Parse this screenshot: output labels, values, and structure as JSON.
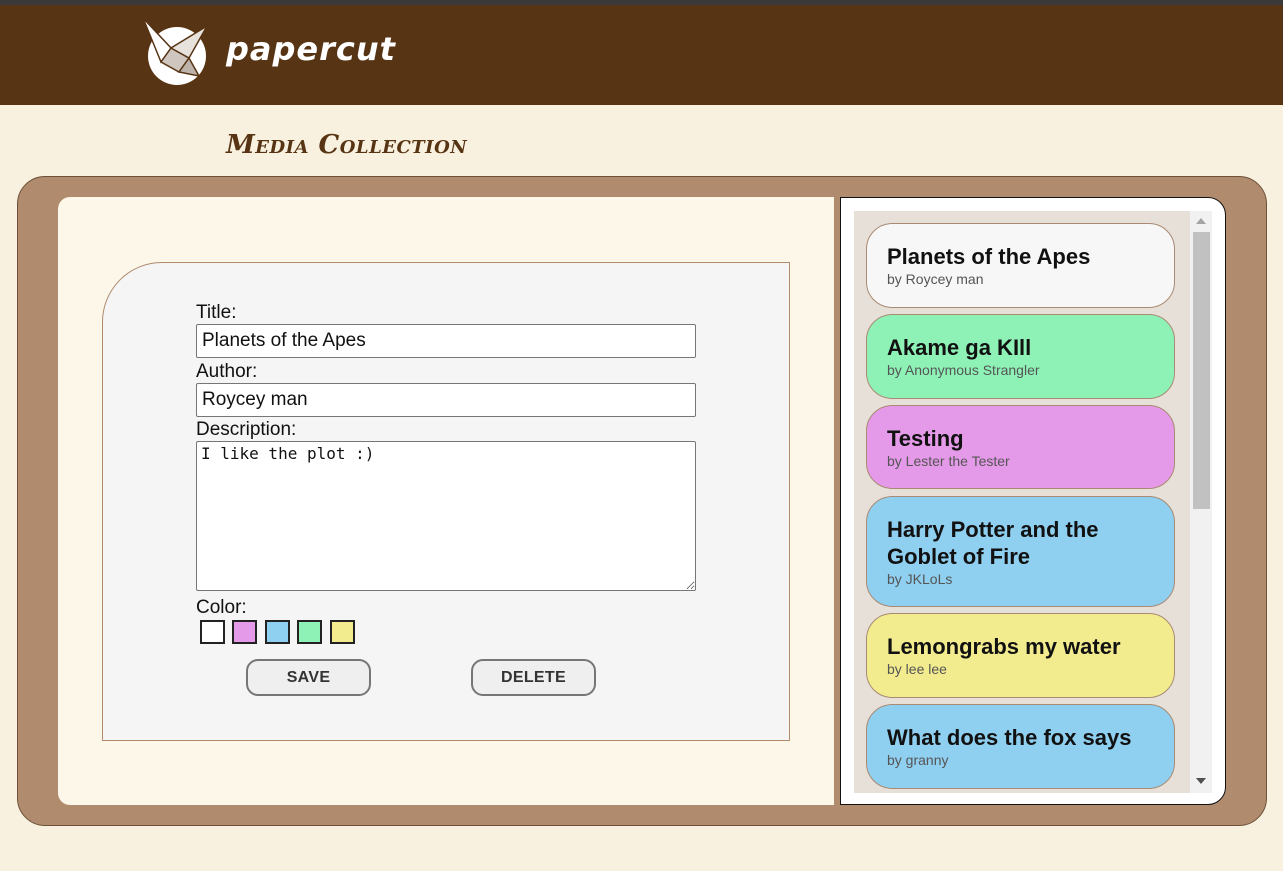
{
  "header": {
    "brand": "papercut",
    "logo_icon": "paper-crane-icon"
  },
  "page": {
    "title": "Media Collection"
  },
  "form": {
    "title_label": "Title:",
    "title_value": "Planets of the Apes",
    "author_label": "Author:",
    "author_value": "Roycey man",
    "description_label": "Description:",
    "description_value": "I like the plot :)",
    "color_label": "Color:",
    "colors": [
      "#ffffff",
      "#e59ae9",
      "#8fcff0",
      "#8ef2b7",
      "#f2ec8f"
    ],
    "save_label": "SAVE",
    "delete_label": "DELETE"
  },
  "media": [
    {
      "title": "Planets of the Apes",
      "author": "by Roycey man",
      "color": "#f7f7f7"
    },
    {
      "title": "Akame ga KIll",
      "author": "by Anonymous Strangler",
      "color": "#8ef2b7"
    },
    {
      "title": "Testing",
      "author": "by Lester the Tester",
      "color": "#e59ae9"
    },
    {
      "title": "Harry Potter and the Goblet of Fire",
      "author": "by JKLoLs",
      "color": "#8fcff0"
    },
    {
      "title": "Lemongrabs my water",
      "author": "by lee lee",
      "color": "#f2ec8f"
    },
    {
      "title": "What does the fox says",
      "author": "by granny",
      "color": "#8fcff0"
    }
  ]
}
